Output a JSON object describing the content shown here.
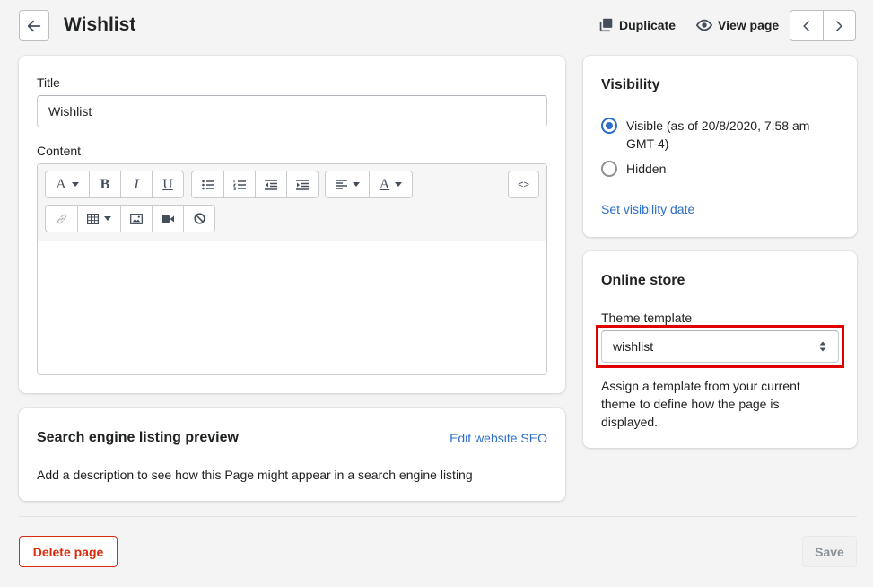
{
  "header": {
    "title": "Wishlist",
    "duplicate_label": "Duplicate",
    "view_page_label": "View page"
  },
  "main": {
    "title_label": "Title",
    "title_value": "Wishlist",
    "content_label": "Content",
    "toolbar": {
      "html_label": "<>",
      "bold_glyph": "B",
      "italic_glyph": "I",
      "underline_glyph": "U",
      "font_glyph": "A",
      "color_glyph": "A"
    }
  },
  "seo": {
    "title": "Search engine listing preview",
    "edit_link": "Edit website SEO",
    "description": "Add a description to see how this Page might appear in a search engine listing"
  },
  "visibility": {
    "title": "Visibility",
    "options": [
      {
        "label": "Visible (as of 20/8/2020, 7:58 am GMT-4)",
        "selected": true
      },
      {
        "label": "Hidden",
        "selected": false
      }
    ],
    "set_date_link": "Set visibility date"
  },
  "online_store": {
    "title": "Online store",
    "template_label": "Theme template",
    "template_value": "wishlist",
    "help_text": "Assign a template from your current theme to define how the page is displayed."
  },
  "footer": {
    "delete_label": "Delete page",
    "save_label": "Save"
  },
  "colors": {
    "accent": "#2c6ecb",
    "critical": "#d82c0d",
    "highlight": "#e00000",
    "background": "#f4f4f4"
  }
}
